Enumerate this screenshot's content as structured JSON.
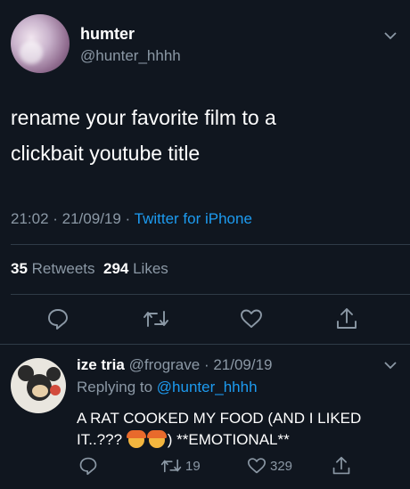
{
  "tweet": {
    "display_name": "humter",
    "handle": "@hunter_hhhh",
    "text_line1": "rename your favorite film to a",
    "text_line2": "clickbait youtube title",
    "time_date": "21:02 · 21/09/19 · ",
    "source": "Twitter for iPhone",
    "retweets_count": "35",
    "retweets_label": "Retweets",
    "likes_count": "294",
    "likes_label": "Likes"
  },
  "reply": {
    "display_name": "ize tria",
    "handle_date": "@frograve · 21/09/19",
    "replying_label": "Replying to",
    "replying_handle": "@hunter_hhhh",
    "text_part1": "A RAT COOKED MY FOOD (AND I LIKED IT..??? ",
    "emoji_name": "exploding-head-emoji",
    "text_part2": ") **EMOTIONAL**",
    "retweet_count": "19",
    "like_count": "329"
  },
  "icons": {
    "reply": "reply-icon",
    "retweet": "retweet-icon",
    "like": "heart-icon",
    "share": "share-icon",
    "more": "chevron-down-icon"
  },
  "colors": {
    "background": "#10161f",
    "link": "#1d9bf0",
    "muted": "#8b98a5"
  }
}
